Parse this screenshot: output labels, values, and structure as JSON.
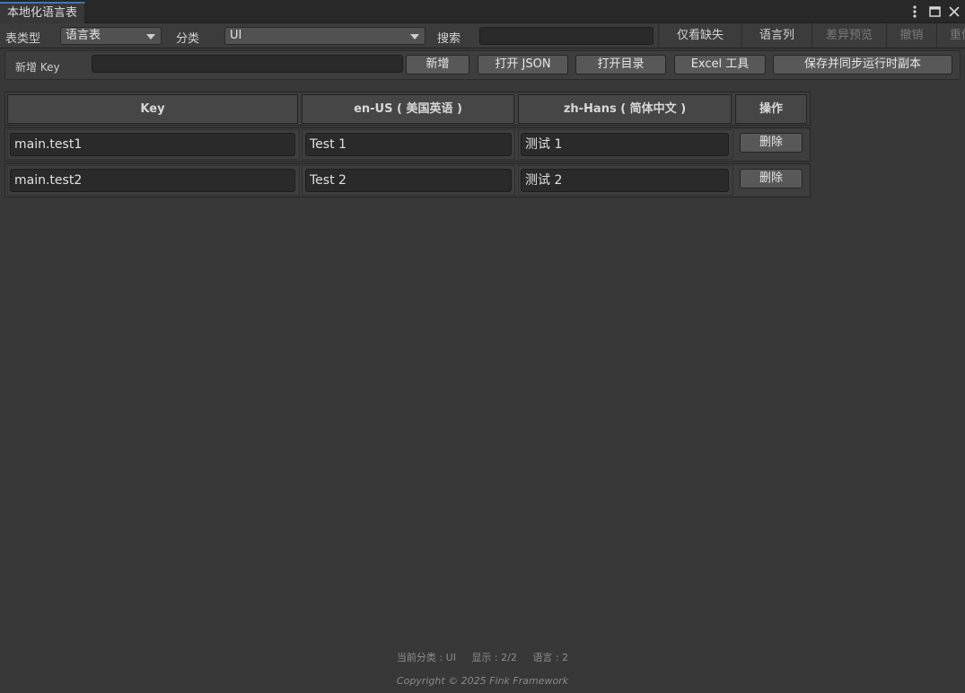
{
  "window": {
    "tab_title": "本地化语言表",
    "menu_icon": "kebab-menu-icon",
    "maximize_icon": "maximize-icon",
    "close_icon": "close-icon"
  },
  "toolbar": {
    "table_type_label": "表类型",
    "table_type_value": "语言表",
    "category_label": "分类",
    "category_value": "UI",
    "search_label": "搜索",
    "search_value": "",
    "buttons": {
      "missing_only": "仅看缺失",
      "language_columns": "语言列",
      "diff_preview": "差异预览",
      "undo": "撤销",
      "redo": "重做"
    }
  },
  "add_panel": {
    "new_key_label": "新增 Key",
    "new_key_value": "",
    "add_button": "新增",
    "open_json_button": "打开 JSON",
    "open_dir_button": "打开目录",
    "excel_button": "Excel 工具",
    "save_sync_button": "保存并同步运行时副本"
  },
  "table": {
    "headers": [
      "Key",
      "en-US ( 美国英语 )",
      "zh-Hans ( 简体中文 )",
      "操作"
    ],
    "rows": [
      {
        "key": "main.test1",
        "en": "Test 1",
        "zh": "测试 1",
        "action": "删除"
      },
      {
        "key": "main.test2",
        "en": "Test 2",
        "zh": "测试 2",
        "action": "删除"
      }
    ]
  },
  "footer": {
    "current_category": "当前分类 : UI",
    "display": "显示 : 2/2",
    "languages": "语言 : 2",
    "copyright": "Copyright © 2025 Fink Framework"
  },
  "colors": {
    "background": "#383838",
    "tab_accent": "#3a79bb",
    "button": "#585858",
    "input": "#2a2a2a"
  }
}
